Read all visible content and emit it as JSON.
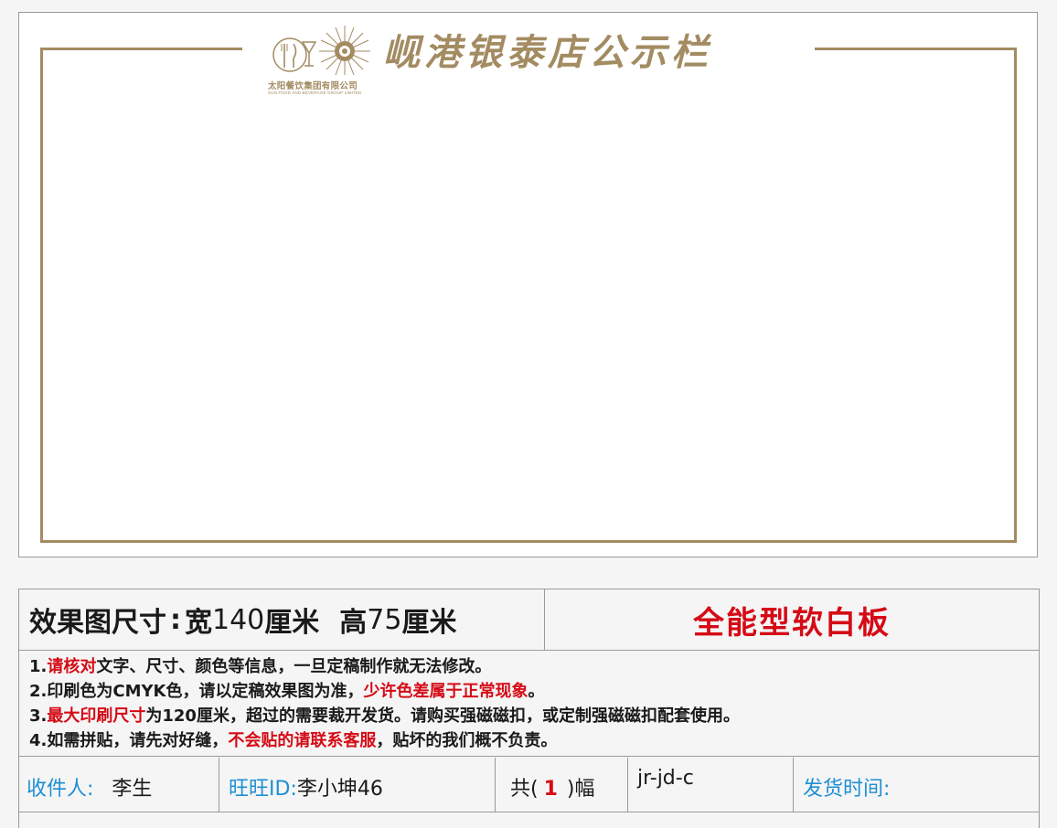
{
  "board": {
    "title": "岘港银泰店公示栏",
    "logo_cn": "太阳餐饮集团有限公司",
    "logo_en": "SUN FOOD AND BEVERAGE GROUP LIMITED",
    "frame_color": "#a38b62"
  },
  "spec": {
    "size_label": "效果图尺寸",
    "colon": ":",
    "width_label": "宽",
    "width_value": "140",
    "width_unit": "厘米",
    "height_label": "高",
    "height_value": "75",
    "height_unit": "厘米",
    "material": "全能型软白板"
  },
  "notes": [
    {
      "prefix": "1.",
      "red": "请核对",
      "text": "文字、尺寸、颜色等信息，一旦定稿制作就无法修改。"
    },
    {
      "prefix": "2.",
      "text": "印刷色为CMYK色，请以定稿效果图为准，",
      "red": "少许色差属于正常现象",
      "suffix": "。"
    },
    {
      "prefix": "3.",
      "red": "最大印刷尺寸",
      "text": "为120厘米，超过的需要裁开发货。请购买强磁磁扣，或定制强磁磁扣配套使用。"
    },
    {
      "prefix": "4.",
      "text": "如需拼贴，请先对好缝，",
      "red": "不会贴的请联系客服",
      "suffix": "，贴坏的我们概不负责。"
    }
  ],
  "order": {
    "recipient_label": "收件人:",
    "recipient": "李生",
    "wangwang_label": "旺旺ID:",
    "wangwang": "李小坤46",
    "count_prefix": "共(",
    "count": "1",
    "count_suffix": ")幅",
    "code": "jr-jd-c",
    "ship_label": "发货时间:"
  },
  "colors": {
    "accent_red": "#d50b16",
    "label_blue": "#1e8fd4",
    "gold": "#a38b62"
  }
}
